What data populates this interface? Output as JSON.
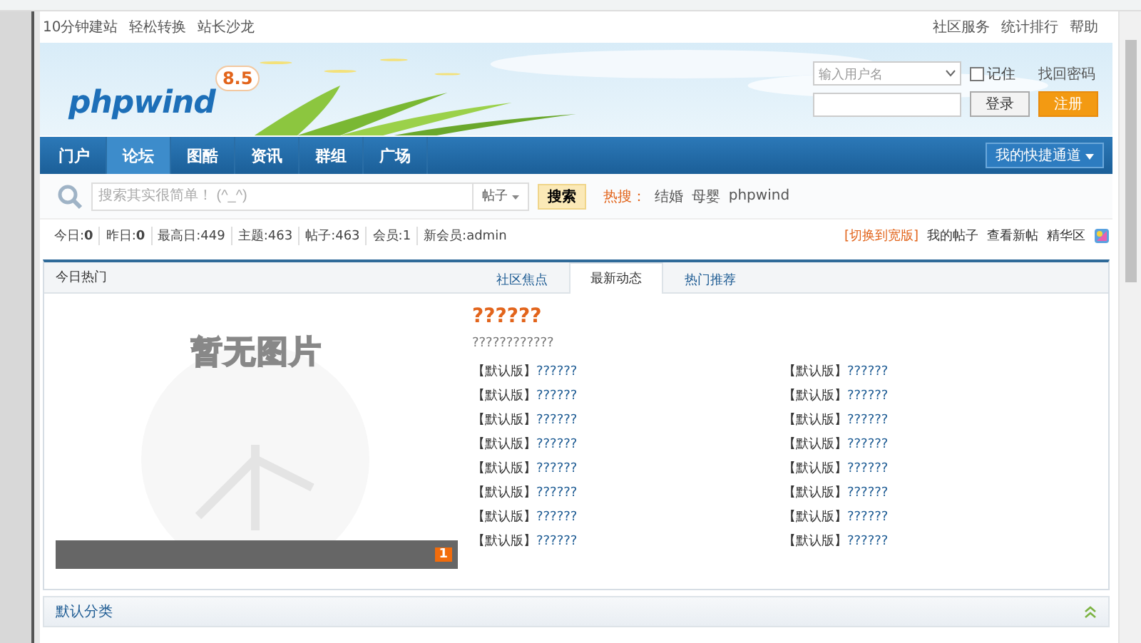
{
  "top_links": {
    "left": [
      "10分钟建站",
      "轻松转换",
      "站长沙龙"
    ],
    "right": [
      "社区服务",
      "统计排行",
      "帮助"
    ]
  },
  "logo": {
    "name": "phpwind",
    "version": "8.5"
  },
  "login": {
    "username_placeholder": "输入用户名",
    "remember": {
      "label": "记住",
      "checked": false
    },
    "forgot": "找回密码",
    "login_button": "登录",
    "register_button": "注册"
  },
  "nav": {
    "items": [
      {
        "label": "门户",
        "selected": false
      },
      {
        "label": "论坛",
        "selected": true
      },
      {
        "label": "图酷",
        "selected": false
      },
      {
        "label": "资讯",
        "selected": false
      },
      {
        "label": "群组",
        "selected": false
      },
      {
        "label": "广场",
        "selected": false
      }
    ],
    "shortcut": "我的快捷通道"
  },
  "search": {
    "placeholder": "搜索其实很简单！ (^_^)",
    "scope": "帖子",
    "button": "搜索",
    "hot_label": "热搜：",
    "hot_terms": [
      "结婚",
      "母婴",
      "phpwind"
    ]
  },
  "stats": [
    "今日:**0**",
    "昨日:**0**",
    "最高日:449",
    "主题:463",
    "帖子:463",
    "会员:1",
    "新会员:admin"
  ],
  "quick_links": {
    "switch": "[切换到宽版]",
    "links": [
      "我的帖子",
      "查看新帖",
      "精华区"
    ]
  },
  "hot_panel": {
    "title": "今日热门",
    "tabs": [
      {
        "label": "社区焦点",
        "selected": false
      },
      {
        "label": "最新动态",
        "selected": true
      },
      {
        "label": "热门推荐",
        "selected": false
      }
    ],
    "slide": {
      "placeholder_text": "暂无图片",
      "page": "1"
    },
    "headline": "??????",
    "summary": "????????????",
    "posts": [
      {
        "forum": "【默认版】",
        "title": "??????"
      },
      {
        "forum": "【默认版】",
        "title": "??????"
      },
      {
        "forum": "【默认版】",
        "title": "??????"
      },
      {
        "forum": "【默认版】",
        "title": "??????"
      },
      {
        "forum": "【默认版】",
        "title": "??????"
      },
      {
        "forum": "【默认版】",
        "title": "??????"
      },
      {
        "forum": "【默认版】",
        "title": "??????"
      },
      {
        "forum": "【默认版】",
        "title": "??????"
      },
      {
        "forum": "【默认版】",
        "title": "??????"
      },
      {
        "forum": "【默认版】",
        "title": "??????"
      },
      {
        "forum": "【默认版】",
        "title": "??????"
      },
      {
        "forum": "【默认版】",
        "title": "??????"
      },
      {
        "forum": "【默认版】",
        "title": "??????"
      },
      {
        "forum": "【默认版】",
        "title": "??????"
      },
      {
        "forum": "【默认版】",
        "title": "??????"
      },
      {
        "forum": "【默认版】",
        "title": "??????"
      }
    ]
  },
  "category": {
    "title": "默认分类",
    "expanded": true
  }
}
